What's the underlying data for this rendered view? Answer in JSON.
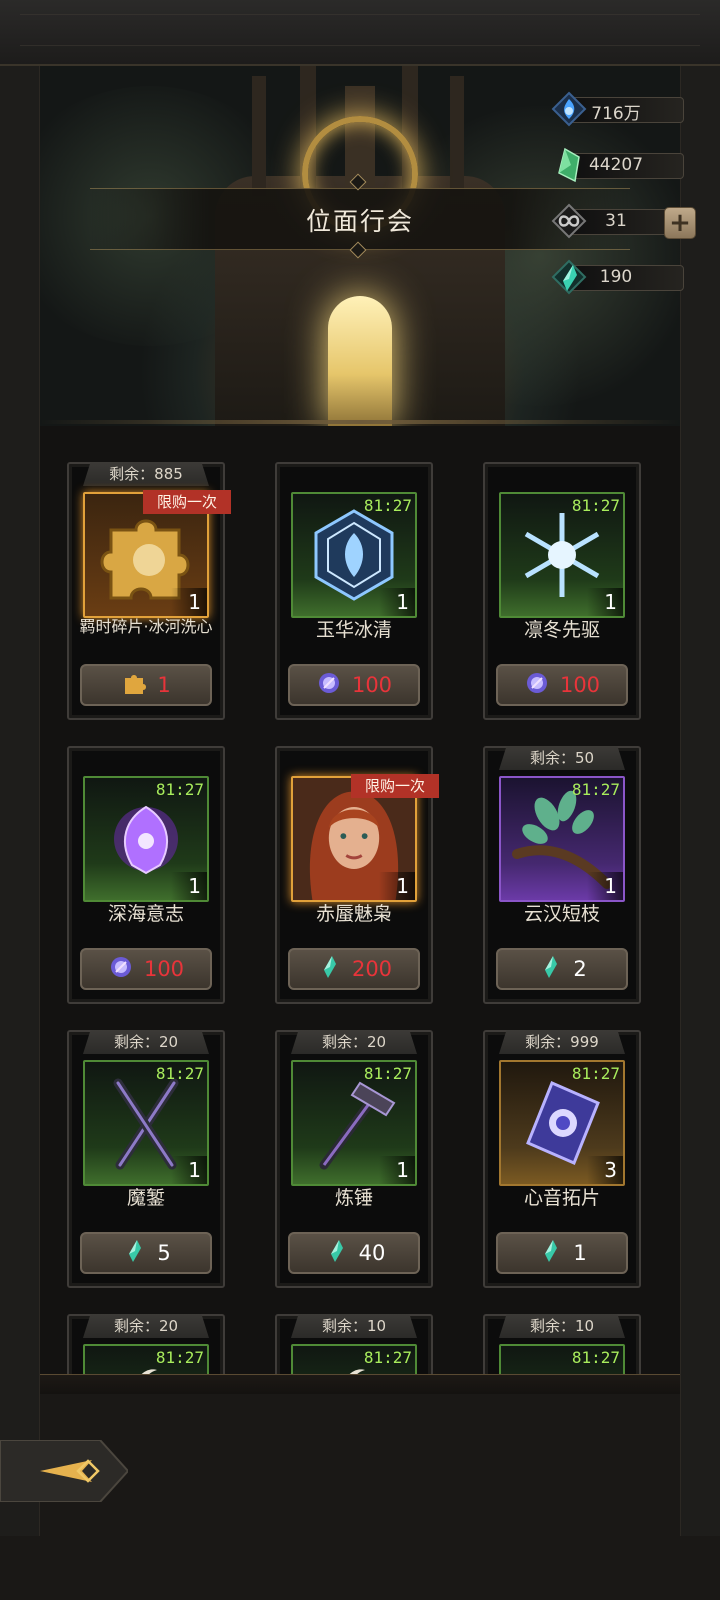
{
  "header": {
    "title": "位面行会"
  },
  "currencies": [
    {
      "icon": "blue-flame-icon",
      "value": "716万"
    },
    {
      "icon": "green-crystal-icon",
      "value": "44207"
    },
    {
      "icon": "infinity-rune-icon",
      "value": "31"
    },
    {
      "icon": "teal-shard-icon",
      "value": "190"
    }
  ],
  "plus_symbol": "+",
  "shop": {
    "items": [
      {
        "remain": "剩余：885",
        "timer": "",
        "limit": "限购一次",
        "qty": "1",
        "name": "羁时碎片·冰河洗心",
        "price": "1",
        "price_icon": "puzzle-icon",
        "price_red": true,
        "frame": "gold"
      },
      {
        "remain": "",
        "timer": "81:27",
        "limit": "",
        "qty": "1",
        "name": "玉华冰清",
        "price": "100",
        "price_icon": "purple-orb-icon",
        "price_red": true,
        "frame": "green"
      },
      {
        "remain": "",
        "timer": "81:27",
        "limit": "",
        "qty": "1",
        "name": "凛冬先驱",
        "price": "100",
        "price_icon": "purple-orb-icon",
        "price_red": true,
        "frame": "green"
      },
      {
        "remain": "",
        "timer": "81:27",
        "limit": "",
        "qty": "1",
        "name": "深海意志",
        "price": "100",
        "price_icon": "purple-orb-icon",
        "price_red": true,
        "frame": "green"
      },
      {
        "remain": "",
        "timer": "",
        "limit": "限购一次",
        "qty": "1",
        "name": "赤蜃魅枭",
        "price": "200",
        "price_icon": "teal-shard-icon",
        "price_red": true,
        "frame": "gold"
      },
      {
        "remain": "剩余：50",
        "timer": "81:27",
        "limit": "",
        "qty": "1",
        "name": "云汉短枝",
        "price": "2",
        "price_icon": "teal-shard-icon",
        "price_red": false,
        "frame": "purple"
      },
      {
        "remain": "剩余：20",
        "timer": "81:27",
        "limit": "",
        "qty": "1",
        "name": "魔錾",
        "price": "5",
        "price_icon": "teal-shard-icon",
        "price_red": false,
        "frame": "green"
      },
      {
        "remain": "剩余：20",
        "timer": "81:27",
        "limit": "",
        "qty": "1",
        "name": "炼锤",
        "price": "40",
        "price_icon": "teal-shard-icon",
        "price_red": false,
        "frame": "green"
      },
      {
        "remain": "剩余：999",
        "timer": "81:27",
        "limit": "",
        "qty": "3",
        "name": "心音拓片",
        "price": "1",
        "price_icon": "teal-shard-icon",
        "price_red": false,
        "frame": "amber"
      },
      {
        "remain": "剩余：20",
        "timer": "81:27",
        "limit": "",
        "qty": "",
        "name": "",
        "price": "",
        "price_icon": "",
        "price_red": false,
        "frame": "green"
      },
      {
        "remain": "剩余：10",
        "timer": "81:27",
        "limit": "",
        "qty": "",
        "name": "",
        "price": "",
        "price_icon": "",
        "price_red": false,
        "frame": "green"
      },
      {
        "remain": "剩余：10",
        "timer": "81:27",
        "limit": "",
        "qty": "",
        "name": "",
        "price": "",
        "price_icon": "",
        "price_red": false,
        "frame": "green"
      }
    ]
  },
  "footer": {
    "back_icon": "back-arrow-icon"
  }
}
